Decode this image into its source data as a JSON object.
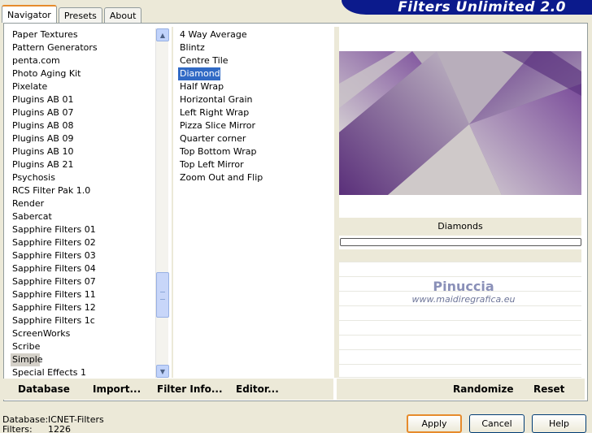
{
  "tabs": [
    "Navigator",
    "Presets",
    "About"
  ],
  "banner_title": "Filters Unlimited 2.0",
  "categories": [
    "Paper Textures",
    "Pattern Generators",
    "penta.com",
    "Photo Aging Kit",
    "Pixelate",
    "Plugins AB 01",
    "Plugins AB 07",
    "Plugins AB 08",
    "Plugins AB 09",
    "Plugins AB 10",
    "Plugins AB 21",
    "Psychosis",
    "RCS Filter Pak 1.0",
    "Render",
    "Sabercat",
    "Sapphire Filters 01",
    "Sapphire Filters 02",
    "Sapphire Filters 03",
    "Sapphire Filters 04",
    "Sapphire Filters 07",
    "Sapphire Filters 11",
    "Sapphire Filters 12",
    "Sapphire Filters 1c",
    "ScreenWorks",
    "Scribe",
    "Simple",
    "Special Effects 1"
  ],
  "selected_category": "Simple",
  "filters": [
    "4 Way Average",
    "Blintz",
    "Centre Tile",
    "Diamonds",
    "Half Wrap",
    "Horizontal Grain",
    "Left Right Wrap",
    "Pizza Slice Mirror",
    "Quarter corner",
    "Top Bottom Wrap",
    "Top Left Mirror",
    "Zoom Out and Flip"
  ],
  "selected_filter": "Diamonds",
  "preview_filter_name": "Diamonds",
  "watermark": {
    "signature": "Pinuccia",
    "url": "www.maidiregrafica.eu"
  },
  "left_buttons": {
    "database": "Database",
    "import": "Import...",
    "filter_info": "Filter Info...",
    "editor": "Editor..."
  },
  "right_buttons": {
    "randomize": "Randomize",
    "reset": "Reset"
  },
  "status": {
    "database_label": "Database:",
    "database_value": "ICNET-Filters",
    "filters_label": "Filters:",
    "filters_value": "1226"
  },
  "dialog_buttons": {
    "apply": "Apply",
    "cancel": "Cancel",
    "help": "Help"
  },
  "colors": {
    "selection": "#316ac5",
    "banner": "#0b1a8c",
    "focus": "#e68b2c"
  }
}
